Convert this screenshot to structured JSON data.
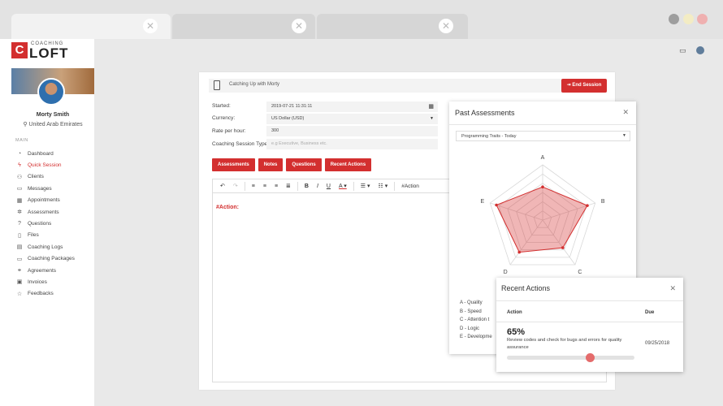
{
  "app": {
    "logo_letter": "C",
    "logo_small": "COACHING",
    "logo_big": "LOFT"
  },
  "profile": {
    "name": "Morty Smith",
    "location": "United Arab Emirates"
  },
  "sidebar": {
    "section_label": "MAIN",
    "items": [
      {
        "label": "Dashboard",
        "icon": "dashboard-icon",
        "glyph": "◔",
        "active": false
      },
      {
        "label": "Quick Session",
        "icon": "bolt-icon",
        "glyph": "ϟ",
        "active": true
      },
      {
        "label": "Clients",
        "icon": "users-icon",
        "glyph": "⚇",
        "active": false
      },
      {
        "label": "Messages",
        "icon": "chat-icon",
        "glyph": "▭",
        "active": false
      },
      {
        "label": "Appointments",
        "icon": "calendar-icon",
        "glyph": "▦",
        "active": false
      },
      {
        "label": "Assessments",
        "icon": "gear-icon",
        "glyph": "✲",
        "active": false
      },
      {
        "label": "Questions",
        "icon": "question-icon",
        "glyph": "?",
        "active": false
      },
      {
        "label": "Files",
        "icon": "file-icon",
        "glyph": "▯",
        "active": false
      },
      {
        "label": "Coaching Logs",
        "icon": "log-icon",
        "glyph": "▤",
        "active": false
      },
      {
        "label": "Coaching Packages",
        "icon": "package-icon",
        "glyph": "▭",
        "active": false
      },
      {
        "label": "Agreements",
        "icon": "handshake-icon",
        "glyph": "⚭",
        "active": false
      },
      {
        "label": "Invoices",
        "icon": "invoice-icon",
        "glyph": "▣",
        "active": false
      },
      {
        "label": "Feedbacks",
        "icon": "star-icon",
        "glyph": "☆",
        "active": false
      }
    ]
  },
  "session": {
    "title": "Catching Up with Morty",
    "end_label": "End Session",
    "started_label": "Started:",
    "started_value": "2019-07-21 11:31:11",
    "currency_label": "Currency:",
    "currency_value": "US Dollar (USD)",
    "rate_label": "Rate per hour:",
    "rate_value": "300",
    "type_label": "Coaching Session Type:",
    "type_placeholder": "e.g Executive, Business etc.",
    "buttons": [
      "Assessments",
      "Notes",
      "Questions",
      "Recent Actions"
    ],
    "toolbar_tag": "#Action",
    "editor_text": "#Action:"
  },
  "past_assessments": {
    "title": "Past Assessments",
    "selected": "Programming Traits - Today",
    "legend": [
      "A - Quality",
      "B - Speed",
      "C - Attention t",
      "D - Logic",
      "E - Developme"
    ]
  },
  "chart_data": {
    "type": "radar",
    "axes": [
      "A",
      "B",
      "C",
      "D",
      "E"
    ],
    "values": [
      0.6,
      0.85,
      0.62,
      0.72,
      0.88
    ],
    "range": [
      0,
      1
    ],
    "rings": 6,
    "color": "#d32f2f"
  },
  "recent_actions": {
    "title": "Recent Actions",
    "col_action": "Action",
    "col_due": "Due",
    "percent_text": "65%",
    "progress": 0.65,
    "description": "Review codes and check for bugs and errors for quality assurance",
    "due": "09/25/2018"
  },
  "colors": {
    "accent": "#d32f2f"
  }
}
